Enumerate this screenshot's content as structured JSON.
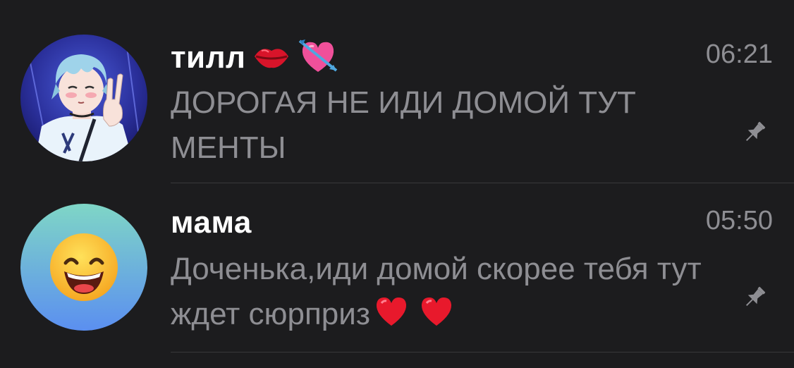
{
  "chats": [
    {
      "name": "тилл",
      "emojis": [
        "lips-icon",
        "heart-with-arrow-icon"
      ],
      "time": "06:21",
      "preview": "ДОРОГАЯ НЕ ИДИ ДОМОЙ ТУТ МЕНТЫ",
      "pinned": true,
      "avatar": "anime-character-avatar"
    },
    {
      "name": "мама",
      "emojis": [
        "red-heart-icon",
        "red-heart-icon"
      ],
      "time": "05:50",
      "preview": "Доченька,иди домой скорее тебя тут ждет сюрприз",
      "pinned": true,
      "avatar": "grinning-emoji-avatar"
    }
  ],
  "colors": {
    "background": "#1c1c1e",
    "name": "#ffffff",
    "secondary": "#8e8e93",
    "divider": "#38383a",
    "heart": "#e8192c"
  }
}
